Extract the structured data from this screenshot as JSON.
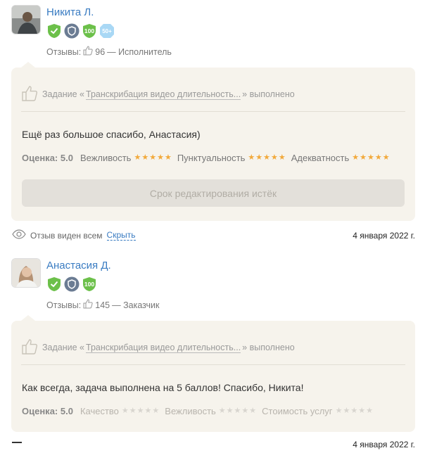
{
  "reviews": [
    {
      "author": "Никита Л.",
      "badges": [
        "verified-check-icon",
        "shield-badge-icon",
        "100",
        "50+"
      ],
      "stats_label": "Отзывы:",
      "stats_count": "96",
      "stats_role": "— Исполнитель",
      "task_prefix": "Задание «",
      "task_link": "Транскрибация видео длительность...",
      "task_suffix": "» выполнено",
      "comment": "Ещё раз большое спасибо, Анастасия)",
      "rating_label": "Оценка: 5.0",
      "criteria": [
        {
          "name": "Вежливость",
          "stars": 5
        },
        {
          "name": "Пунктуальность",
          "stars": 5
        },
        {
          "name": "Адекватность",
          "stars": 5
        }
      ],
      "edit_button": "Срок редактирования истёк",
      "visibility_text": "Отзыв виден всем",
      "hide_link": "Скрыть",
      "date": "4 января 2022 г."
    },
    {
      "author": "Анастасия Д.",
      "badges": [
        "verified-check-icon",
        "shield-badge-icon",
        "100"
      ],
      "stats_label": "Отзывы:",
      "stats_count": "145",
      "stats_role": "— Заказчик",
      "task_prefix": "Задание «",
      "task_link": "Транскрибация видео длительность...",
      "task_suffix": "» выполнено",
      "comment": "Как всегда, задача выполнена на 5 баллов! Спасибо, Никита!",
      "rating_label": "Оценка: 5.0",
      "criteria": [
        {
          "name": "Качество",
          "stars": 0
        },
        {
          "name": "Вежливость",
          "stars": 0
        },
        {
          "name": "Стоимость услуг",
          "stars": 0
        }
      ],
      "date": "4 января 2022 г."
    }
  ],
  "colors": {
    "link": "#3a7cc2",
    "card_bg": "#f6f3ec",
    "star_filled": "#f2a93b",
    "star_empty": "#d8d5cf",
    "badge_green": "#6cc04a",
    "badge_slate": "#6b7c93",
    "badge_light_blue": "#a9d8f5"
  }
}
